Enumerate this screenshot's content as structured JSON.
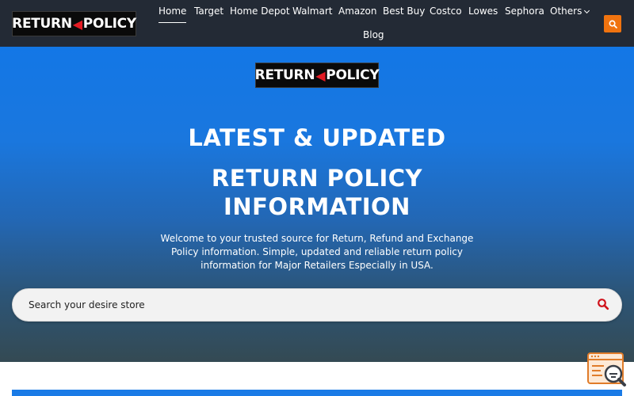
{
  "header": {
    "logo_left": "RETURN",
    "logo_right": "POLICY",
    "nav": [
      {
        "label": "Home",
        "active": true
      },
      {
        "label": "Target"
      },
      {
        "label": "Home Depot"
      },
      {
        "label": "Walmart"
      },
      {
        "label": "Amazon"
      },
      {
        "label": "Best Buy"
      },
      {
        "label": "Costco"
      },
      {
        "label": "Lowes"
      },
      {
        "label": "Sephora"
      },
      {
        "label": "Others"
      },
      {
        "label": "Blog"
      }
    ],
    "search_icon": "search-icon"
  },
  "hero": {
    "logo_left": "RETURN",
    "logo_right": "POLICY",
    "title_line1": "LATEST & UPDATED",
    "title_line2": "RETURN POLICY",
    "title_line3": "INFORMATION",
    "intro": "Welcome to your trusted source for Return, Refund and Exchange Policy information. Simple, updated and reliable return policy information for Major Retailers Especially in USA.",
    "search_placeholder": "Search your desire store"
  },
  "colors": {
    "header_bg": "#232a35",
    "accent_orange": "#f0730f",
    "hero_blue": "#1377e6",
    "search_icon_red": "#d0121b"
  }
}
